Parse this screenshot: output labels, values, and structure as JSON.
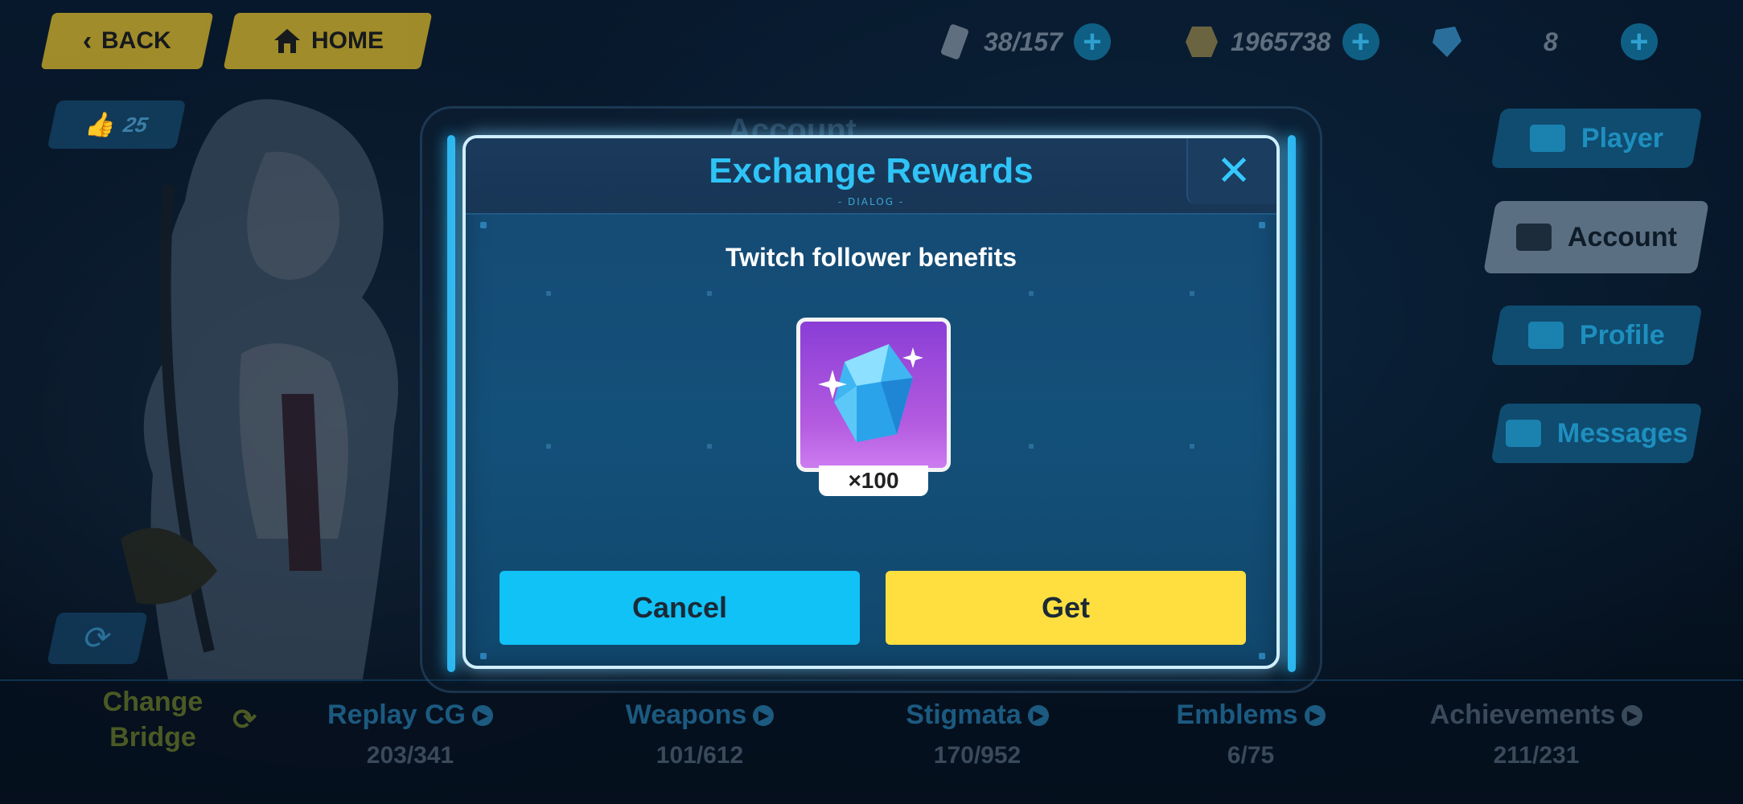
{
  "nav": {
    "back_label": "BACK",
    "home_label": "HOME"
  },
  "resources": [
    {
      "icon": "stamina-icon",
      "value": "38/157"
    },
    {
      "icon": "coin-icon",
      "value": "1965738"
    },
    {
      "icon": "crystal-icon",
      "value": "8"
    }
  ],
  "likes": "25",
  "side_tabs": [
    {
      "label": "Player",
      "active": false
    },
    {
      "label": "Account",
      "active": true
    },
    {
      "label": "Profile",
      "active": false
    },
    {
      "label": "Messages",
      "active": false
    }
  ],
  "bottom": {
    "change_bridge": "Change Bridge",
    "stats": [
      {
        "label": "Replay CG",
        "value": "203/341"
      },
      {
        "label": "Weapons",
        "value": "101/612"
      },
      {
        "label": "Stigmata",
        "value": "170/952"
      },
      {
        "label": "Emblems",
        "value": "6/75"
      },
      {
        "label": "Achievements",
        "value": "211/231"
      }
    ]
  },
  "background_panel_title": "Account",
  "dialog": {
    "title": "Exchange Rewards",
    "subtitle": "- DIALOG -",
    "message": "Twitch follower benefits",
    "reward": {
      "icon": "crystal-icon",
      "quantity": "×100"
    },
    "cancel_label": "Cancel",
    "get_label": "Get"
  }
}
